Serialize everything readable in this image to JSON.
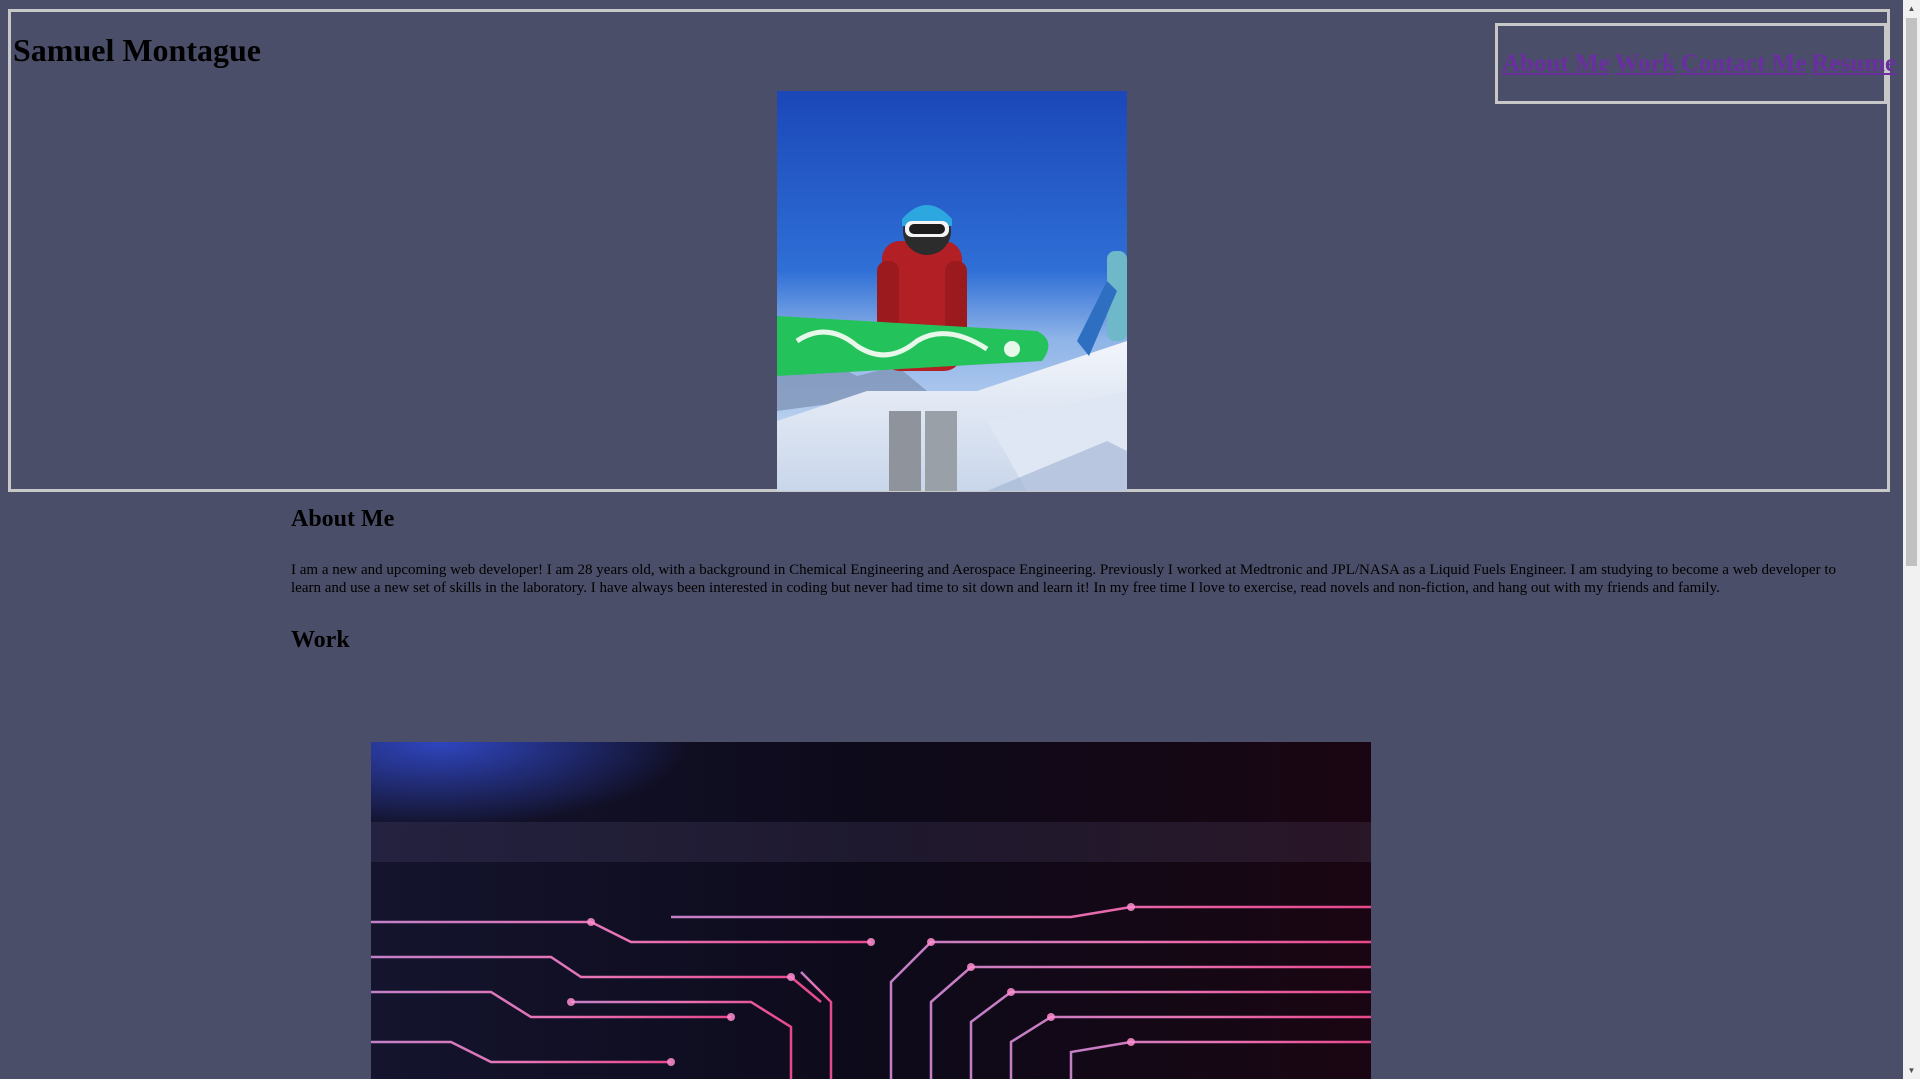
{
  "header": {
    "site_title": "Samuel Montague",
    "nav": [
      {
        "label": "About Me"
      },
      {
        "label": "Work"
      },
      {
        "label": "Contact Me"
      },
      {
        "label": "Resume"
      }
    ]
  },
  "about": {
    "heading": "About Me",
    "text": "I am a new and upcoming web developer! I am 28 years old, with a background in Chemical Engineering and Aerospace Engineering. Previously I worked at Medtronic and JPL/NASA as a Liquid Fuels Engineer. I am studying to become a web developer to learn and use a new set of skills in the laboratory. I have always been interested in coding but never had time to sit down and learn it! In my free time I love to exercise, read novels and non-fiction, and hang out with my friends and family."
  },
  "work": {
    "heading": "Work"
  },
  "colors": {
    "background": "#4b4e69",
    "border": "#c8c8c8",
    "link": "#6a2ea0"
  },
  "images": {
    "hero": "snowboarder-photo",
    "work": "circuit-board-image"
  }
}
